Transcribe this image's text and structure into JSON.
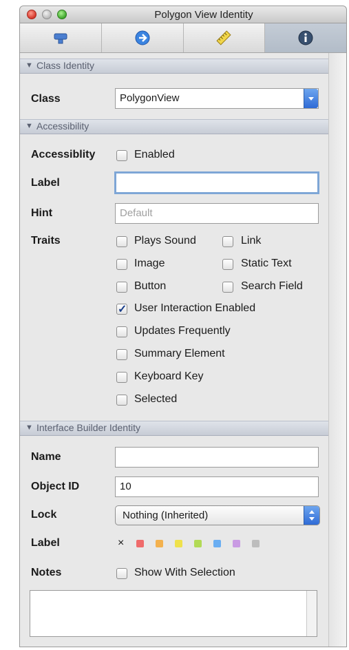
{
  "window": {
    "title": "Polygon View Identity"
  },
  "toolbar": {
    "tabs": [
      "attributes-icon",
      "connections-icon",
      "size-icon",
      "identity-icon"
    ],
    "active_tab": 3
  },
  "sections": {
    "class_identity": {
      "title": "Class Identity",
      "class_label": "Class",
      "class_value": "PolygonView"
    },
    "accessibility": {
      "title": "Accessibility",
      "accessibility_label": "Accessiblity",
      "enabled_label": "Enabled",
      "label_label": "Label",
      "label_value": "",
      "hint_label": "Hint",
      "hint_placeholder": "Default",
      "traits_label": "Traits",
      "traits": {
        "plays_sound": "Plays Sound",
        "link": "Link",
        "image": "Image",
        "static_text": "Static Text",
        "button": "Button",
        "search_field": "Search Field",
        "user_interaction": "User Interaction Enabled",
        "updates_frequently": "Updates Frequently",
        "summary_element": "Summary Element",
        "keyboard_key": "Keyboard Key",
        "selected": "Selected"
      },
      "checked": {
        "user_interaction": true
      }
    },
    "ib_identity": {
      "title": "Interface Builder Identity",
      "name_label": "Name",
      "name_value": "",
      "object_id_label": "Object ID",
      "object_id_value": "10",
      "lock_label": "Lock",
      "lock_value": "Nothing (Inherited)",
      "color_label_label": "Label",
      "clear_glyph": "×",
      "label_colors": [
        "#ef6b6b",
        "#f3b14e",
        "#efe14c",
        "#b2da56",
        "#6aaef2",
        "#c99be3",
        "#bdbdbd"
      ],
      "notes_label": "Notes",
      "show_with_selection": "Show With Selection",
      "notes_value": ""
    }
  }
}
